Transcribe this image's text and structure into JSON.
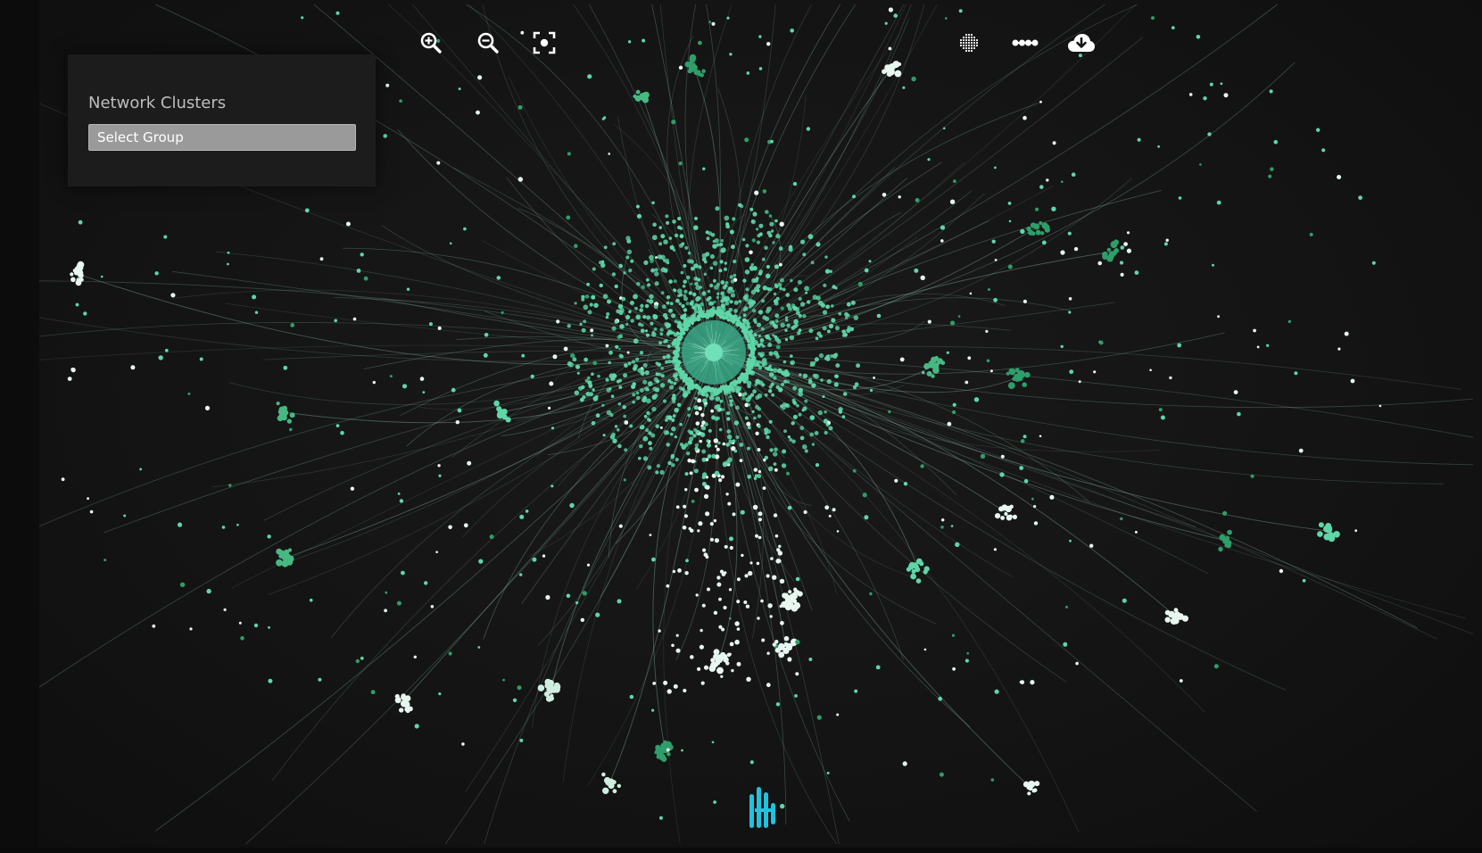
{
  "panel": {
    "title": "Network Clusters",
    "select_value": "Select Group"
  },
  "colors": {
    "background": "#141414",
    "node_green": "#5fd6a8",
    "node_dark_green": "#2e9e6a",
    "node_white": "#e6f5ef",
    "edge": "#9ad8bf",
    "brand_cyan": "#1fc3e0",
    "select_bg": "#9a9a9a"
  },
  "toolbar": {
    "zoom_in_icon": "zoom-in-icon",
    "zoom_out_icon": "zoom-out-icon",
    "fit_icon": "fit-view-icon",
    "layout_icon": "dot-grid-icon",
    "edges_icon": "link-dots-icon",
    "download_icon": "cloud-download-icon"
  },
  "brand": {
    "icon": "brand-logo-icon"
  }
}
